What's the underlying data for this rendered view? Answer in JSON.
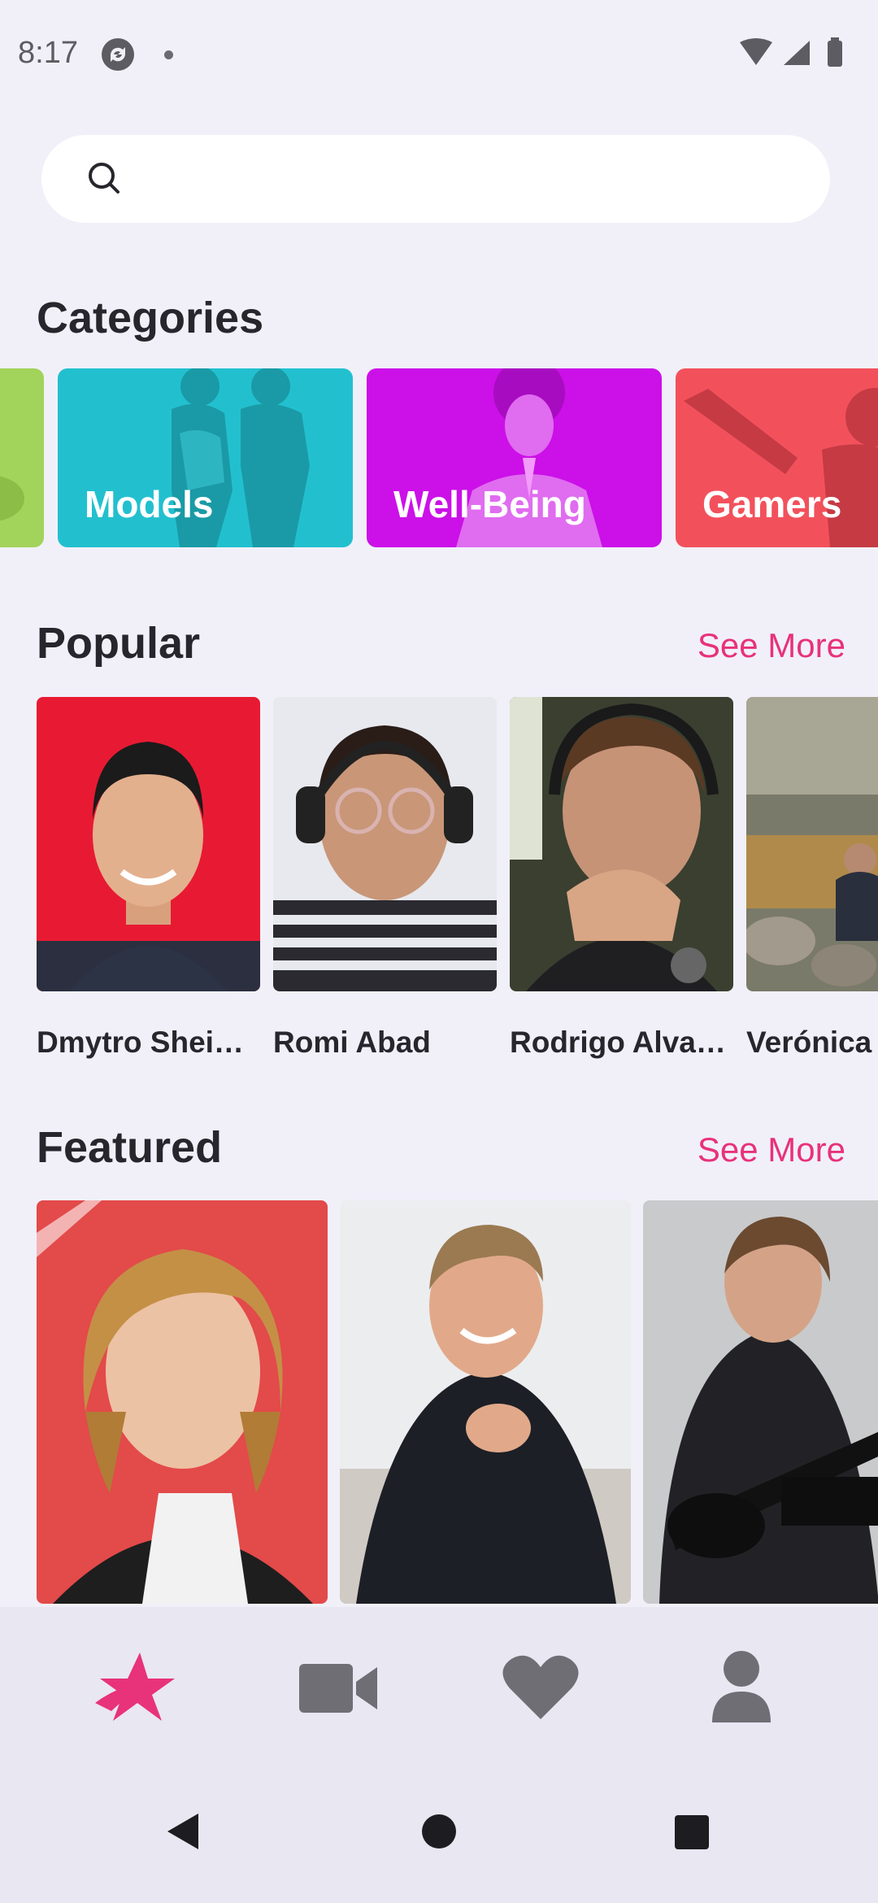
{
  "status_bar": {
    "time": "8:17"
  },
  "search": {
    "placeholder": "",
    "value": ""
  },
  "categories": {
    "title": "Categories",
    "items": [
      {
        "label": "",
        "color": "#a2d35a"
      },
      {
        "label": "Models",
        "color": "#22c0cf"
      },
      {
        "label": "Well-Being",
        "color": "#cc10e8"
      },
      {
        "label": "Gamers",
        "color": "#f2515c"
      }
    ]
  },
  "popular": {
    "title": "Popular",
    "see_more": "See More",
    "items": [
      {
        "name": "Dmytro Shei…"
      },
      {
        "name": "Romi Abad"
      },
      {
        "name": "Rodrigo Alva…"
      },
      {
        "name": "Verónica"
      }
    ]
  },
  "featured": {
    "title": "Featured",
    "see_more": "See More"
  },
  "bottom_nav": {
    "items": [
      {
        "icon": "star-logo-icon",
        "active": true
      },
      {
        "icon": "video-camera-icon",
        "active": false
      },
      {
        "icon": "heart-icon",
        "active": false
      },
      {
        "icon": "person-icon",
        "active": false
      }
    ],
    "active_color": "#e8327a",
    "inactive_color": "#6e6e74"
  },
  "system_nav": {
    "buttons": [
      "back-icon",
      "home-icon",
      "recents-icon"
    ]
  }
}
